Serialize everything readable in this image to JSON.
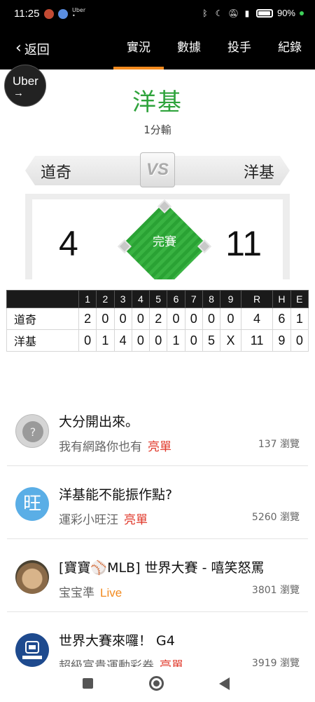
{
  "status_bar": {
    "time": "11:25",
    "battery": "90%",
    "icons": [
      "bluetooth-icon",
      "moon-icon",
      "bell-off-icon",
      "volte-icon",
      "4g-signal-icon",
      "battery-icon"
    ]
  },
  "nav": {
    "back_label": "返回",
    "tabs": [
      {
        "label": "實況",
        "active": true
      },
      {
        "label": "數據",
        "active": false
      },
      {
        "label": "投手",
        "active": false
      },
      {
        "label": "紀錄",
        "active": false
      }
    ]
  },
  "floating": {
    "uber_label": "Uber",
    "uber_arrow": "→"
  },
  "game": {
    "winner": "洋基",
    "result": "1分輸",
    "away_team": "道奇",
    "home_team": "洋基",
    "vs": "VS",
    "away_score": "4",
    "home_score": "11",
    "status": "完賽"
  },
  "linescore": {
    "headers": [
      "",
      "1",
      "2",
      "3",
      "4",
      "5",
      "6",
      "7",
      "8",
      "9",
      "R",
      "H",
      "E"
    ],
    "rows": [
      [
        "道奇",
        "2",
        "0",
        "0",
        "0",
        "2",
        "0",
        "0",
        "0",
        "0",
        "4",
        "6",
        "1"
      ],
      [
        "洋基",
        "0",
        "1",
        "4",
        "0",
        "0",
        "1",
        "0",
        "5",
        "X",
        "11",
        "9",
        "0"
      ]
    ]
  },
  "posts": [
    {
      "title": "大分開出來。",
      "author": "我有網路你也有",
      "tag": "亮單",
      "tag_color": "red",
      "views": "137 瀏覽",
      "avatar_icon": "placeholder-avatar-icon"
    },
    {
      "title": "洋基能不能振作點?",
      "author": "運彩小旺汪",
      "tag": "亮單",
      "tag_color": "red",
      "views": "5260 瀏覽",
      "avatar_text": "旺"
    },
    {
      "title": "[寶寶⚾MLB] 世界大賽 - 嘻笑怒罵",
      "author": "宝宝準",
      "tag": "Live",
      "tag_color": "orange",
      "views": "3801 瀏覽",
      "avatar_icon": "pug-avatar-icon"
    },
    {
      "title": "世界大賽來囉！ G4",
      "author": "超級富貴運動彩券",
      "tag": "亮單",
      "tag_color": "red",
      "views": "3919 瀏覽",
      "avatar_icon": "lottery-shop-logo-icon"
    }
  ],
  "colors": {
    "accent_orange": "#f28a1f",
    "winner_green": "#2fa33c",
    "tag_red": "#e0392b"
  }
}
